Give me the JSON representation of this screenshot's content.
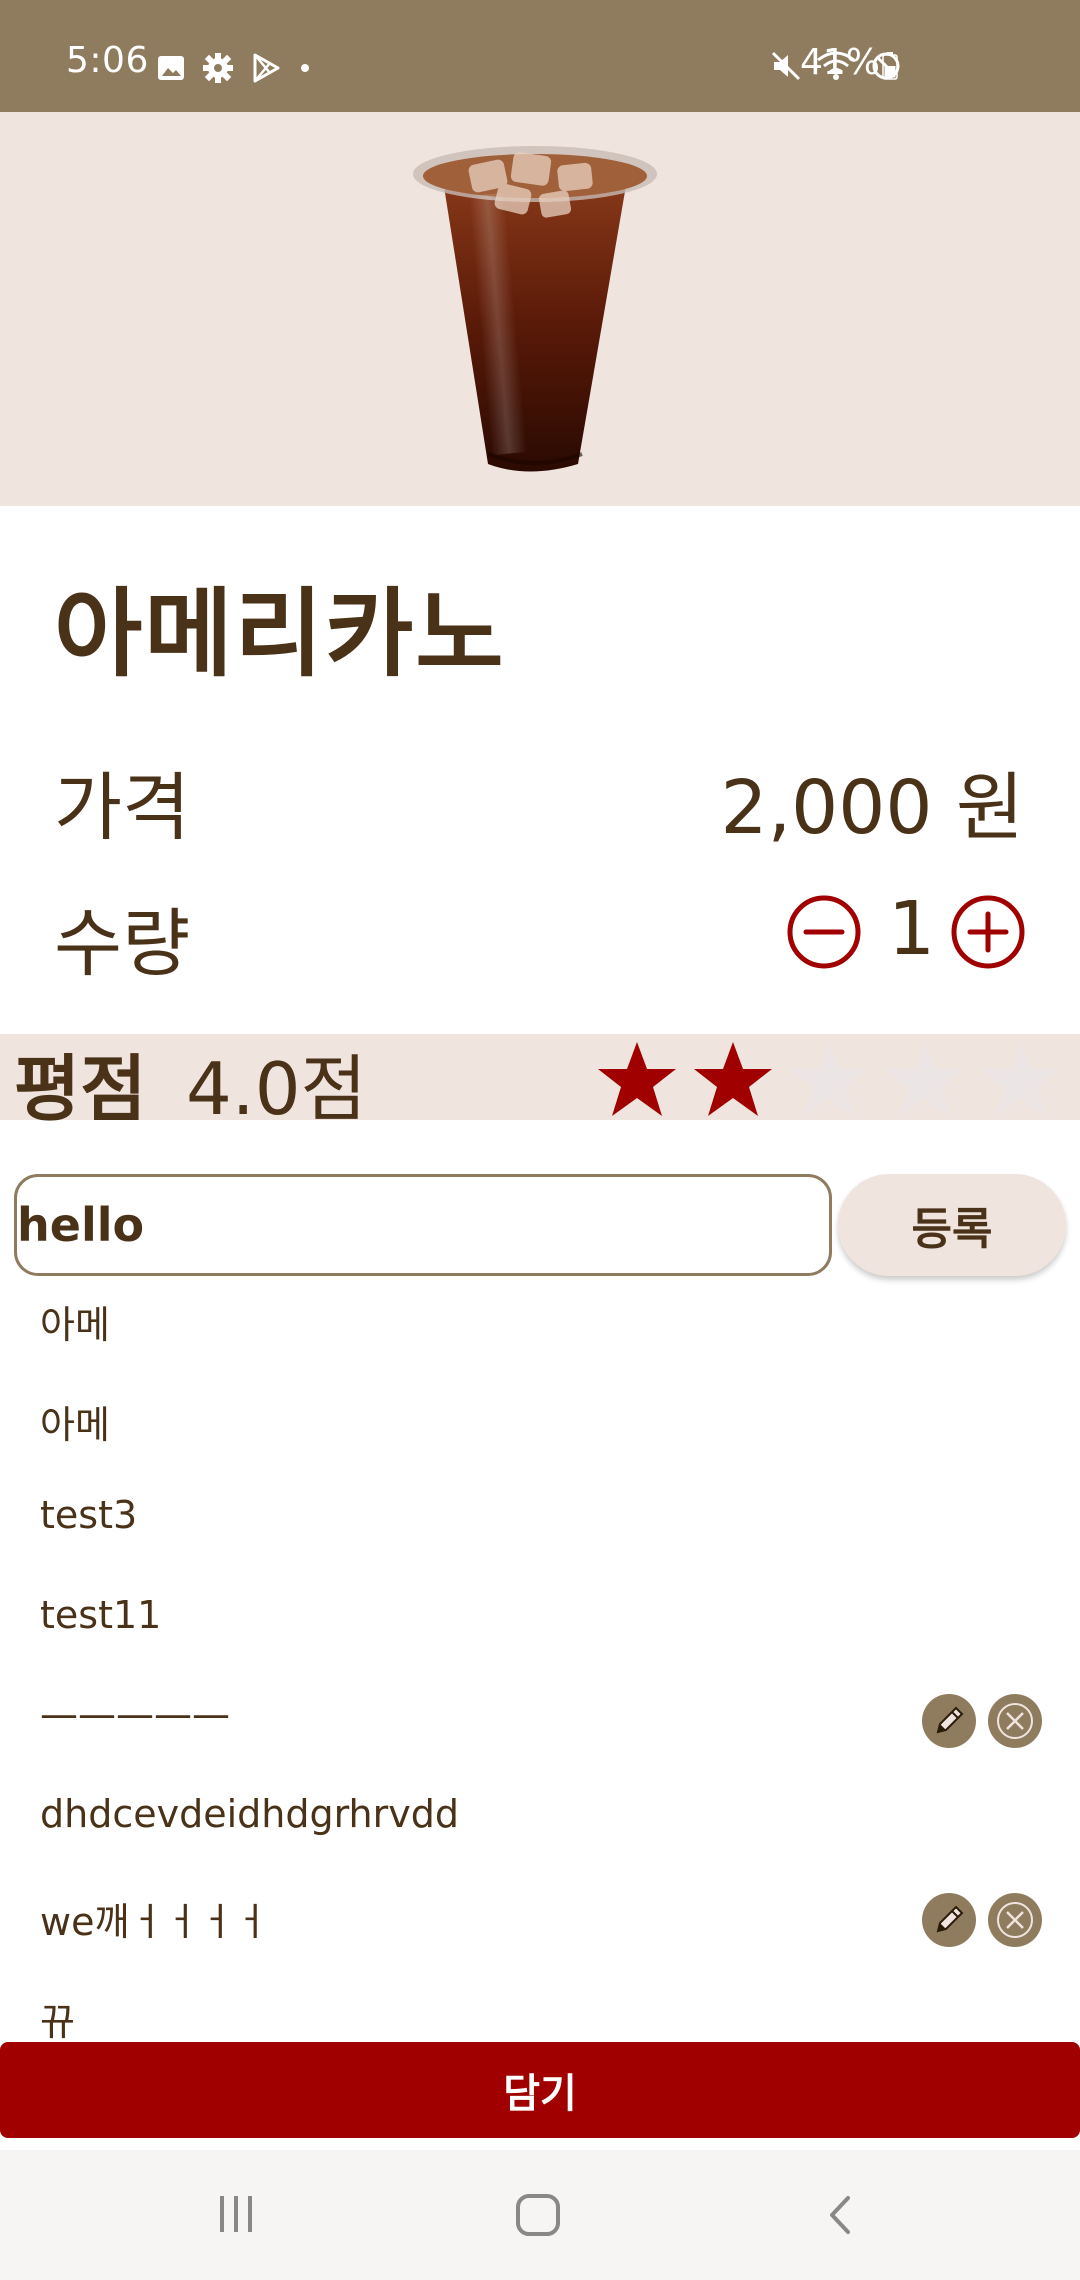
{
  "status_bar": {
    "time": "5:06",
    "battery": "41%",
    "left_icons": [
      "gallery-icon",
      "settings-icon",
      "play-store-icon",
      "dot-icon"
    ],
    "right_icons": [
      "mute-icon",
      "wifi-icon",
      "do-not-disturb-icon",
      "battery-icon"
    ],
    "background": "#8f7c5f"
  },
  "product": {
    "image": "iced-americano-image",
    "name": "아메리카노",
    "price_label": "가격",
    "price_value": "2,000 원",
    "quantity_label": "수량",
    "quantity_value": "1"
  },
  "rating": {
    "label": "평점",
    "score_text": "4.0점",
    "filled_stars": 2,
    "total_stars": 5
  },
  "review_form": {
    "input_value": "hello",
    "submit_label": "등록"
  },
  "reviews": [
    {
      "text": "아메",
      "editable": false
    },
    {
      "text": "아메",
      "editable": false
    },
    {
      "text": "test3",
      "editable": false
    },
    {
      "text": "test11",
      "editable": false
    },
    {
      "text": "—————",
      "editable": true
    },
    {
      "text": "dhdcevdeidhdgrhrvdd",
      "editable": false
    },
    {
      "text": "we깨ㅓㅓㅓㅓ",
      "editable": true
    },
    {
      "text": "뀨",
      "editable": false
    }
  ],
  "add_to_cart_label": "담기",
  "colors": {
    "accent": "#a00000",
    "brown_text": "#4a3218",
    "band": "#f0e4df",
    "icon_bg": "#8f7c5f"
  }
}
